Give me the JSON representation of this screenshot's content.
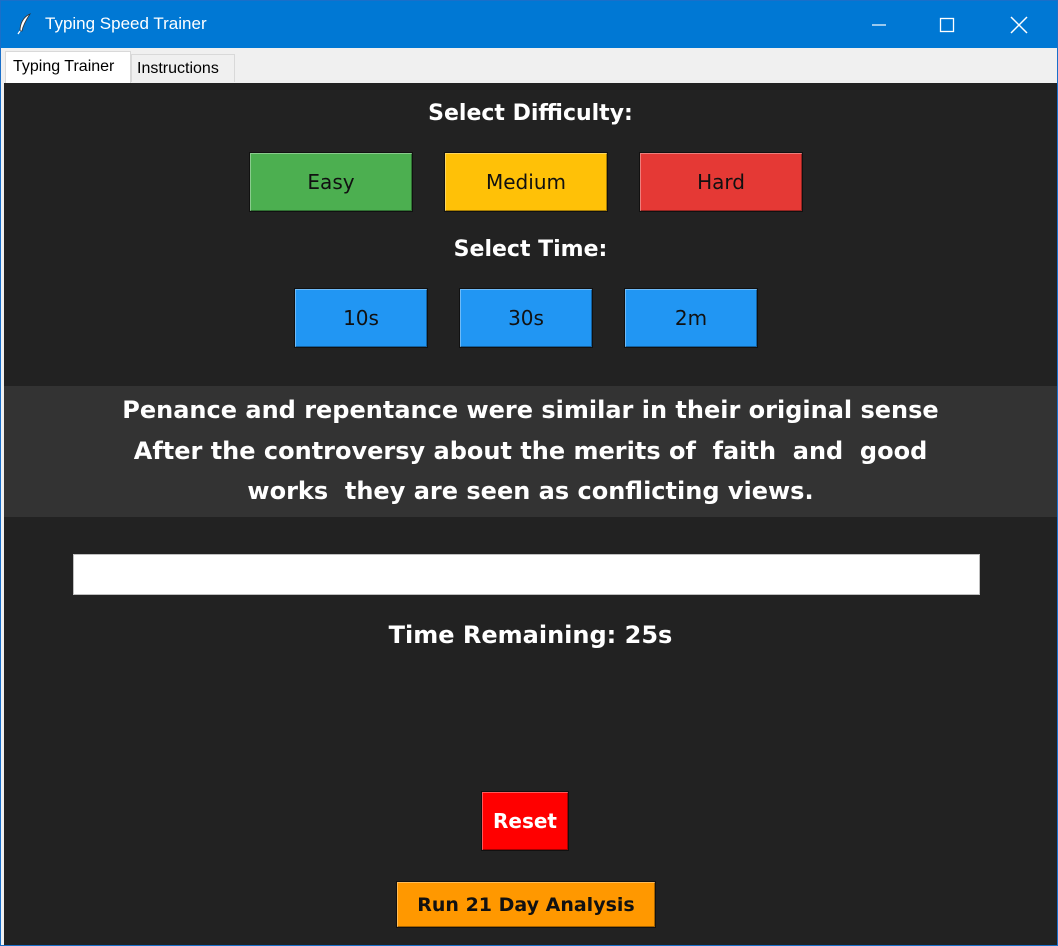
{
  "window": {
    "title": "Typing Speed Trainer",
    "app_icon": "feather-icon",
    "controls": [
      "minimize-icon",
      "maximize-icon",
      "close-icon"
    ],
    "titlebar_color": "#0078d4"
  },
  "tabs": [
    {
      "label": "Typing Trainer",
      "active": true
    },
    {
      "label": "Instructions",
      "active": false
    }
  ],
  "difficulty": {
    "label": "Select Difficulty:",
    "options": [
      {
        "label": "Easy",
        "color": "#4caf50"
      },
      {
        "label": "Medium",
        "color": "#ffc107"
      },
      {
        "label": "Hard",
        "color": "#e53935"
      }
    ]
  },
  "time_select": {
    "label": "Select Time:",
    "options": [
      {
        "label": "10s",
        "color": "#2196f3"
      },
      {
        "label": "30s",
        "color": "#2196f3"
      },
      {
        "label": "2m",
        "color": "#2196f3"
      }
    ]
  },
  "sample_text": {
    "lines": [
      "Penance and repentance were similar in their original sense",
      "After the controversy about the merits of  faith  and  good",
      "works  they are seen as conflicting views."
    ]
  },
  "typing_input": {
    "value": "",
    "placeholder": ""
  },
  "status": {
    "time_remaining": "Time Remaining: 25s"
  },
  "actions": {
    "reset_label": "Reset",
    "reset_color": "#ff0000",
    "analysis_label": "Run 21 Day Analysis",
    "analysis_color": "#ff9800"
  },
  "colors": {
    "background": "#222222",
    "sample_panel": "#333333",
    "text": "#ffffff"
  }
}
